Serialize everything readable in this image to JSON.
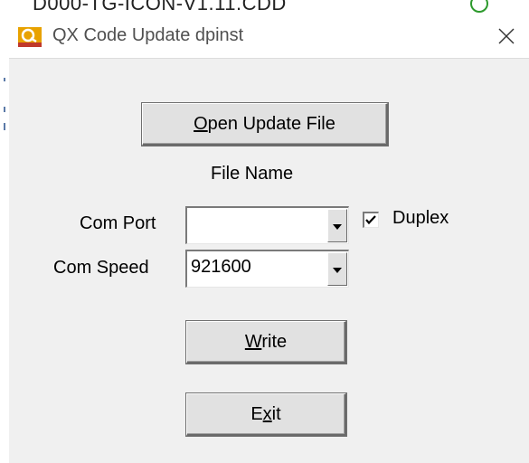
{
  "background": {
    "text": "D000-TG-ICON-V1.11.CDD"
  },
  "window": {
    "title": "QX Code Update dpinst",
    "icon": "app-logo-icon",
    "close_icon": "close-icon"
  },
  "buttons": {
    "open_update_file": {
      "label_pre": "",
      "label_mnemonic": "O",
      "label_post": "pen Update File"
    },
    "write": {
      "label_pre": "",
      "label_mnemonic": "W",
      "label_post": "rite"
    },
    "exit": {
      "label_pre": "E",
      "label_mnemonic": "x",
      "label_post": "it"
    }
  },
  "file_name_label": "File Name",
  "com_port": {
    "label": "Com Port",
    "value": ""
  },
  "com_speed": {
    "label": "Com Speed",
    "value": "921600"
  },
  "duplex": {
    "label": "Duplex",
    "checked": true
  },
  "colors": {
    "accent_icon": "#e8a200",
    "close_icon": "#333333"
  }
}
